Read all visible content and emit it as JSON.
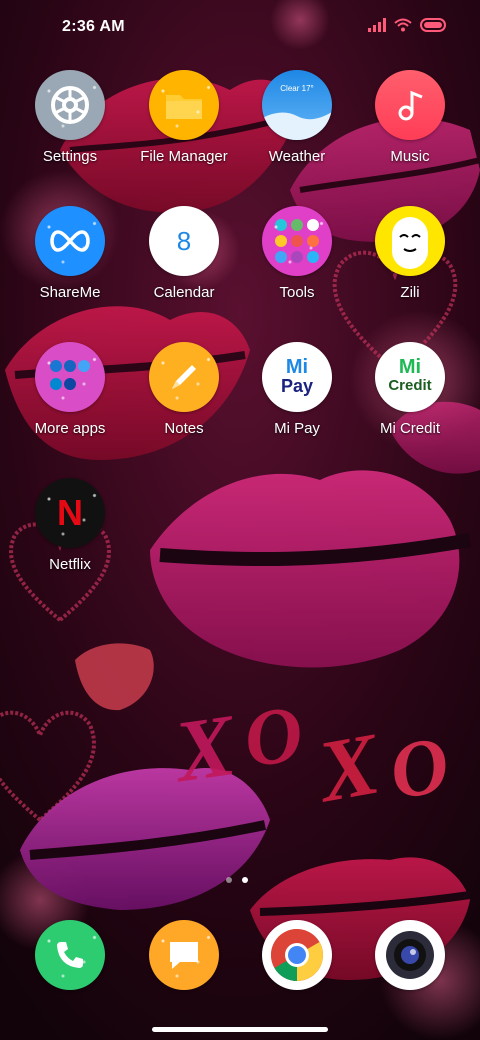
{
  "status_bar": {
    "time": "2:36 AM",
    "icons": [
      "signal-icon",
      "wifi-icon",
      "battery-icon"
    ],
    "battery_color": "#ff4d6d"
  },
  "apps": {
    "settings": "Settings",
    "file_manager": "File Manager",
    "weather": "Weather",
    "weather_badge": "Clear 17°",
    "music": "Music",
    "shareme": "ShareMe",
    "calendar": "Calendar",
    "calendar_day": "8",
    "tools": "Tools",
    "zili": "Zili",
    "more_apps": "More apps",
    "notes": "Notes",
    "mipay": "Mi Pay",
    "mipay_logo_top": "Mi",
    "mipay_logo_bottom": "Pay",
    "micredit": "Mi Credit",
    "micredit_logo_top": "Mi",
    "micredit_logo_bottom": "Credit",
    "netflix": "Netflix",
    "netflix_logo": "N"
  },
  "dock": [
    "phone-icon",
    "messages-icon",
    "chrome-icon",
    "camera-icon"
  ],
  "page_indicator": {
    "pages": 2,
    "active": 2
  },
  "wallpaper": {
    "text": "XOXO"
  }
}
